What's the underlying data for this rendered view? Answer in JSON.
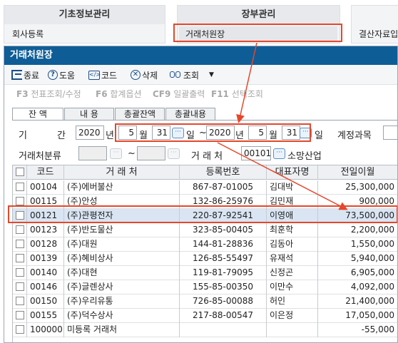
{
  "menu": {
    "col1": {
      "title": "기초정보관리",
      "item": "회사등록"
    },
    "col2": {
      "title": "장부관리",
      "item": "거래처원장"
    },
    "col3": {
      "item": "결산자료입"
    }
  },
  "window": {
    "title": "거래처원장"
  },
  "toolbar": [
    {
      "label": "종료",
      "icon": "exit-icon"
    },
    {
      "label": "도움",
      "icon": "help-icon"
    },
    {
      "label": "코드",
      "icon": "code-icon"
    },
    {
      "label": "삭제",
      "icon": "delete-icon"
    },
    {
      "label": "조회",
      "icon": "search-icon"
    }
  ],
  "fkeys": [
    {
      "key": "F3",
      "label": "전표조회/수정"
    },
    {
      "key": "F6",
      "label": "합계옵션"
    },
    {
      "key": "CF9",
      "label": "일괄출력"
    },
    {
      "key": "F11",
      "label": "선택조회"
    }
  ],
  "tabs": [
    "잔 액",
    "내 용",
    "총괄잔액",
    "총괄내용"
  ],
  "filters": {
    "period_label1": "기",
    "period_label2": "간",
    "from_year": "2020",
    "year_unit": "년",
    "from_month": "5",
    "month_unit": "월",
    "from_day": "31",
    "day_unit": "일",
    "tilde": "~",
    "to_year": "2020",
    "to_month": "5",
    "to_day": "31",
    "account_label": "계정과목",
    "partner_class_label": "거래처분류",
    "partner_label": "거 래 처",
    "partner_code": "00101",
    "partner_name": "소망산업"
  },
  "table": {
    "headers": [
      "코드",
      "거 래 처",
      "등록번호",
      "대표자명",
      "전일이월"
    ],
    "rows": [
      {
        "code": "00104",
        "name": "(주)에버불산",
        "reg": "867-87-01005",
        "ceo": "김대박",
        "amount": "25,300,000"
      },
      {
        "code": "00115",
        "name": "(주)안성",
        "reg": "132-86-25976",
        "ceo": "김민재",
        "amount": "900,000"
      },
      {
        "code": "00121",
        "name": "(주)관평전자",
        "reg": "220-87-92541",
        "ceo": "이영애",
        "amount": "73,500,000"
      },
      {
        "code": "00123",
        "name": "(주)반도물산",
        "reg": "323-85-00405",
        "ceo": "최훈학",
        "amount": "2,200,000"
      },
      {
        "code": "00128",
        "name": "(주)대원",
        "reg": "144-81-28836",
        "ceo": "김동아",
        "amount": "1,550,000"
      },
      {
        "code": "00139",
        "name": "(주)혜비상사",
        "reg": "126-85-55497",
        "ceo": "유재석",
        "amount": "5,940,000"
      },
      {
        "code": "00140",
        "name": "(주)대현",
        "reg": "119-81-79095",
        "ceo": "신정곤",
        "amount": "6,905,000"
      },
      {
        "code": "00146",
        "name": "(주)글렌상사",
        "reg": "155-85-00350",
        "ceo": "이만수",
        "amount": "4,092,000"
      },
      {
        "code": "00150",
        "name": "(주)우리유통",
        "reg": "726-85-00088",
        "ceo": "허인",
        "amount": "21,400,000"
      },
      {
        "code": "00155",
        "name": "(주)덕수상사",
        "reg": "217-88-00547",
        "ceo": "이은정",
        "amount": "17,050,000"
      },
      {
        "code": "100000",
        "name": "미등록 거래처",
        "reg": "",
        "ceo": "",
        "amount": "-55,000"
      }
    ]
  },
  "colors": {
    "titlebar": "#0f5d96",
    "highlight": "#e5472b",
    "selected_row": "#d9e5f3"
  }
}
